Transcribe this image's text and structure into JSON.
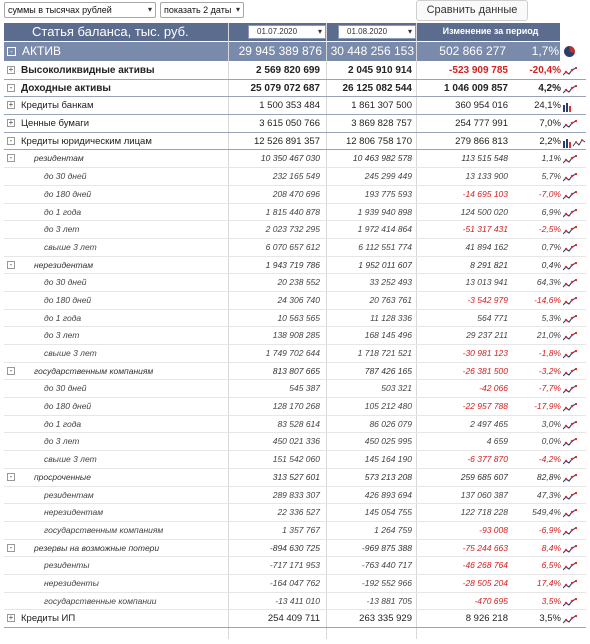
{
  "toolbar": {
    "units_select": "суммы в тысячах рублей",
    "dates_select": "показать 2 даты",
    "compare_button": "Сравнить данные"
  },
  "header": {
    "title": "Статья баланса, тыс. руб.",
    "date1": "01.07.2020",
    "date2": "01.08.2020",
    "change": "Изменение за период"
  },
  "aktiv": {
    "toggle": "-",
    "label": "АКТИВ",
    "v1": "29 945 389 876",
    "v2": "30 448 256 153",
    "change": "502 866 277",
    "pct": "1,7%"
  },
  "rows": [
    {
      "level": 0,
      "bold": true,
      "toggle": "+",
      "label": "Высоколиквидные активы",
      "v1": "2 569 820 699",
      "v2": "2 045 910 914",
      "change": "-523 909 785",
      "pct": "-20,4%",
      "icon": "line"
    },
    {
      "level": 0,
      "bold": true,
      "toggle": "-",
      "label": "Доходные активы",
      "v1": "25 079 072 687",
      "v2": "26 125 082 544",
      "change": "1 046 009 857",
      "pct": "4,2%",
      "icon": "line"
    },
    {
      "level": 1,
      "toggle": "+",
      "label": "Кредиты банкам",
      "v1": "1 500 353 484",
      "v2": "1 861 307 500",
      "change": "360 954 016",
      "pct": "24,1%",
      "icon": "bars"
    },
    {
      "level": 1,
      "toggle": "+",
      "label": "Ценные бумаги",
      "v1": "3 615 050 766",
      "v2": "3 869 828 757",
      "change": "254 777 991",
      "pct": "7,0%",
      "icon": "line"
    },
    {
      "level": 1,
      "toggle": "-",
      "label": "Кредиты юридическим лицам",
      "v1": "12 526 891 357",
      "v2": "12 806 758 170",
      "change": "279 866 813",
      "pct": "2,2%",
      "icon": "barsline"
    },
    {
      "level": 2,
      "toggle": "-",
      "label": "резидентам",
      "v1": "10 350 467 030",
      "v2": "10 463 982 578",
      "change": "113 515 548",
      "pct": "1,1%",
      "icon": "line"
    },
    {
      "level": 3,
      "label": "до 30 дней",
      "v1": "232 165 549",
      "v2": "245 299 449",
      "change": "13 133 900",
      "pct": "5,7%",
      "icon": "line"
    },
    {
      "level": 3,
      "label": "до 180 дней",
      "v1": "208 470 696",
      "v2": "193 775 593",
      "change": "-14 695 103",
      "pct": "-7,0%",
      "icon": "line"
    },
    {
      "level": 3,
      "label": "до 1 года",
      "v1": "1 815 440 878",
      "v2": "1 939 940 898",
      "change": "124 500 020",
      "pct": "6,9%",
      "icon": "line"
    },
    {
      "level": 3,
      "label": "до 3 лет",
      "v1": "2 023 732 295",
      "v2": "1 972 414 864",
      "change": "-51 317 431",
      "pct": "-2,5%",
      "icon": "line"
    },
    {
      "level": 3,
      "label": "свыше 3 лет",
      "v1": "6 070 657 612",
      "v2": "6 112 551 774",
      "change": "41 894 162",
      "pct": "0,7%",
      "icon": "line"
    },
    {
      "level": 2,
      "toggle": "-",
      "label": "нерезидентам",
      "v1": "1 943 719 786",
      "v2": "1 952 011 607",
      "change": "8 291 821",
      "pct": "0,4%",
      "icon": "line"
    },
    {
      "level": 3,
      "label": "до 30 дней",
      "v1": "20 238 552",
      "v2": "33 252 493",
      "change": "13 013 941",
      "pct": "64,3%",
      "icon": "line"
    },
    {
      "level": 3,
      "label": "до 180 дней",
      "v1": "24 306 740",
      "v2": "20 763 761",
      "change": "-3 542 979",
      "pct": "-14,6%",
      "icon": "line"
    },
    {
      "level": 3,
      "label": "до 1 года",
      "v1": "10 563 565",
      "v2": "11 128 336",
      "change": "564 771",
      "pct": "5,3%",
      "icon": "line"
    },
    {
      "level": 3,
      "label": "до 3 лет",
      "v1": "138 908 285",
      "v2": "168 145 496",
      "change": "29 237 211",
      "pct": "21,0%",
      "icon": "line"
    },
    {
      "level": 3,
      "label": "свыше 3 лет",
      "v1": "1 749 702 644",
      "v2": "1 718 721 521",
      "change": "-30 981 123",
      "pct": "-1,8%",
      "icon": "line"
    },
    {
      "level": 2,
      "toggle": "-",
      "label": "государственным компаниям",
      "v1": "813 807 665",
      "v2": "787 426 165",
      "change": "-26 381 500",
      "pct": "-3,2%",
      "icon": "line"
    },
    {
      "level": 3,
      "label": "до 30 дней",
      "v1": "545 387",
      "v2": "503 321",
      "change": "-42 066",
      "pct": "-7,7%",
      "icon": "line"
    },
    {
      "level": 3,
      "label": "до 180 дней",
      "v1": "128 170 268",
      "v2": "105 212 480",
      "change": "-22 957 788",
      "pct": "-17,9%",
      "icon": "line"
    },
    {
      "level": 3,
      "label": "до 1 года",
      "v1": "83 528 614",
      "v2": "86 026 079",
      "change": "2 497 465",
      "pct": "3,0%",
      "icon": "line"
    },
    {
      "level": 3,
      "label": "до 3 лет",
      "v1": "450 021 336",
      "v2": "450 025 995",
      "change": "4 659",
      "pct": "0,0%",
      "icon": "line"
    },
    {
      "level": 3,
      "label": "свыше 3 лет",
      "v1": "151 542 060",
      "v2": "145 164 190",
      "change": "-6 377 870",
      "pct": "-4,2%",
      "icon": "line"
    },
    {
      "level": 2,
      "toggle": "-",
      "label": "просроченные",
      "v1": "313 527 601",
      "v2": "573 213 208",
      "change": "259 685 607",
      "pct": "82,8%",
      "icon": "line"
    },
    {
      "level": 3,
      "label": "резидентам",
      "v1": "289 833 307",
      "v2": "426 893 694",
      "change": "137 060 387",
      "pct": "47,3%",
      "icon": "line"
    },
    {
      "level": 3,
      "label": "нерезидентам",
      "v1": "22 336 527",
      "v2": "145 054 755",
      "change": "122 718 228",
      "pct": "549,4%",
      "icon": "line"
    },
    {
      "level": 3,
      "label": "государственным компаниям",
      "v1": "1 357 767",
      "v2": "1 264 759",
      "change": "-93 008",
      "pct": "-6,9%",
      "icon": "line"
    },
    {
      "level": 2,
      "toggle": "-",
      "label": "резервы на возможные потери",
      "v1": "-894 630 725",
      "v2": "-969 875 388",
      "change": "-75 244 663",
      "pct": "8,4%",
      "icon": "line"
    },
    {
      "level": 3,
      "label": "резиденты",
      "v1": "-717 171 953",
      "v2": "-763 440 717",
      "change": "-46 268 764",
      "pct": "6,5%",
      "icon": "line"
    },
    {
      "level": 3,
      "label": "нерезиденты",
      "v1": "-164 047 762",
      "v2": "-192 552 966",
      "change": "-28 505 204",
      "pct": "17,4%",
      "icon": "line"
    },
    {
      "level": 3,
      "label": "государственные компании",
      "v1": "-13 411 010",
      "v2": "-13 881 705",
      "change": "-470 695",
      "pct": "3,5%",
      "icon": "line"
    },
    {
      "level": 1,
      "toggle": "+",
      "label": "Кредиты ИП",
      "v1": "254 409 711",
      "v2": "263 335 929",
      "change": "8 926 218",
      "pct": "3,5%",
      "icon": "line"
    }
  ],
  "colors": {
    "header_bg": "#5b6c8f",
    "total_bg": "#7a8aab",
    "negative": "#d42020",
    "spark_dark": "#2b3e6b",
    "spark_red": "#e03030"
  }
}
